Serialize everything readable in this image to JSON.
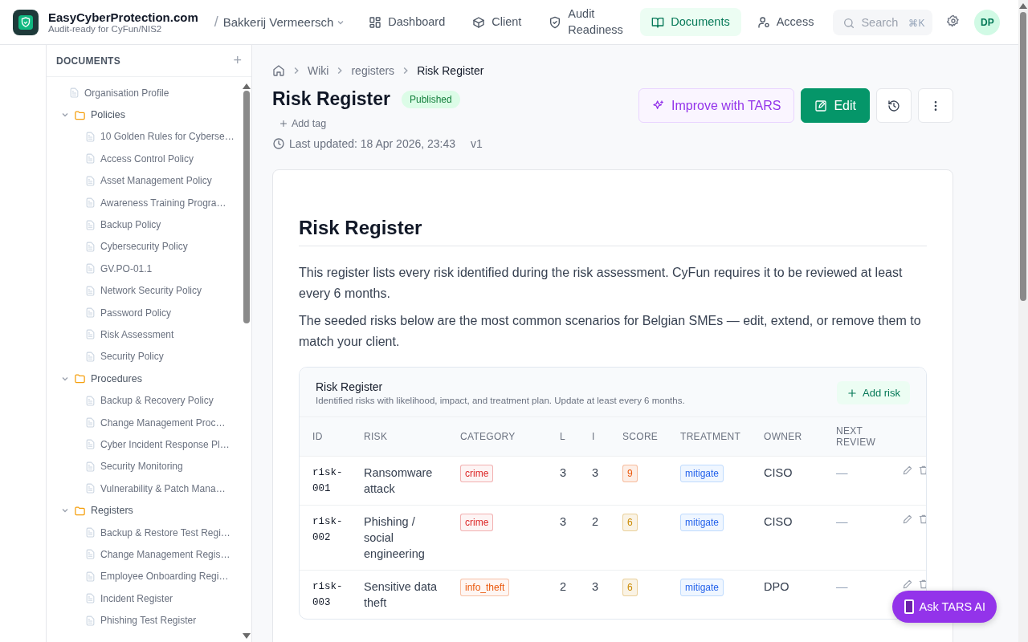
{
  "brand": {
    "name": "EasyCyberProtection.com",
    "tagline": "Audit-ready for CyFun/NIS2"
  },
  "workspace": {
    "separator": "/",
    "name": "Bakkerij Vermeersch"
  },
  "nav": [
    {
      "label": "Dashboard",
      "selected": false
    },
    {
      "label": "Client",
      "selected": false
    },
    {
      "label": "Audit Readiness",
      "selected": false
    },
    {
      "label": "Documents",
      "selected": true
    },
    {
      "label": "Access",
      "selected": false
    }
  ],
  "search": {
    "placeholder": "Search",
    "shortcut": "⌘K"
  },
  "avatar": "DP",
  "sidebar": {
    "title": "DOCUMENTS",
    "add": "+",
    "items": [
      {
        "kind": "file",
        "label": "Organisation Profile"
      },
      {
        "kind": "folder",
        "label": "Policies",
        "expanded": true,
        "children": [
          {
            "kind": "file",
            "label": "10 Golden Rules for Cyberse…"
          },
          {
            "kind": "file",
            "label": "Access Control Policy"
          },
          {
            "kind": "file",
            "label": "Asset Management Policy"
          },
          {
            "kind": "file",
            "label": "Awareness Training Progra…"
          },
          {
            "kind": "file",
            "label": "Backup Policy"
          },
          {
            "kind": "file",
            "label": "Cybersecurity Policy"
          },
          {
            "kind": "file",
            "label": "GV.PO-01.1"
          },
          {
            "kind": "file",
            "label": "Network Security Policy"
          },
          {
            "kind": "file",
            "label": "Password Policy"
          },
          {
            "kind": "file",
            "label": "Risk Assessment"
          },
          {
            "kind": "file",
            "label": "Security Policy"
          }
        ]
      },
      {
        "kind": "folder",
        "label": "Procedures",
        "expanded": true,
        "children": [
          {
            "kind": "file",
            "label": "Backup & Recovery Policy"
          },
          {
            "kind": "file",
            "label": "Change Management Proc…"
          },
          {
            "kind": "file",
            "label": "Cyber Incident Response Pl…"
          },
          {
            "kind": "file",
            "label": "Security Monitoring"
          },
          {
            "kind": "file",
            "label": "Vulnerability & Patch Mana…"
          }
        ]
      },
      {
        "kind": "folder",
        "label": "Registers",
        "expanded": true,
        "children": [
          {
            "kind": "file",
            "label": "Backup & Restore Test Regi…"
          },
          {
            "kind": "file",
            "label": "Change Management Regis…"
          },
          {
            "kind": "file",
            "label": "Employee Onboarding Regi…"
          },
          {
            "kind": "file",
            "label": "Incident Register"
          },
          {
            "kind": "file",
            "label": "Phishing Test Register"
          }
        ]
      }
    ]
  },
  "breadcrumb": [
    "Wiki",
    "registers",
    "Risk Register"
  ],
  "page": {
    "title": "Risk Register",
    "status": "Published",
    "add_tag": "Add tag",
    "updated": "Last updated: 18 Apr 2026, 23:43",
    "version": "v1"
  },
  "actions": {
    "improve": "Improve with TARS",
    "edit": "Edit"
  },
  "doc": {
    "heading": "Risk Register",
    "paragraphs": [
      "This register lists every risk identified during the risk assessment. CyFun requires it to be reviewed at least every 6 months.",
      "The seeded risks below are the most common scenarios for Belgian SMEs — edit, extend, or remove them to match your client."
    ]
  },
  "table": {
    "title": "Risk Register",
    "subtitle": "Identified risks with likelihood, impact, and treatment plan. Update at least every 6 months.",
    "add": "Add risk",
    "columns": [
      "ID",
      "RISK",
      "CATEGORY",
      "L",
      "I",
      "SCORE",
      "TREATMENT",
      "OWNER",
      "NEXT REVIEW"
    ],
    "rows": [
      {
        "id": "risk-001",
        "risk": "Ransomware attack",
        "category": {
          "label": "crime",
          "color": "#dc2626"
        },
        "l": "3",
        "i": "3",
        "score": {
          "value": "9",
          "color": "#ea580c"
        },
        "treatment": "mitigate",
        "owner": "CISO",
        "next_review": "—"
      },
      {
        "id": "risk-002",
        "risk": "Phishing / social engineering",
        "category": {
          "label": "crime",
          "color": "#dc2626"
        },
        "l": "3",
        "i": "2",
        "score": {
          "value": "6",
          "color": "#ca8a04"
        },
        "treatment": "mitigate",
        "owner": "CISO",
        "next_review": "—"
      },
      {
        "id": "risk-003",
        "risk": "Sensitive data theft",
        "category": {
          "label": "info_theft",
          "color": "#ea580c"
        },
        "l": "2",
        "i": "3",
        "score": {
          "value": "6",
          "color": "#ca8a04"
        },
        "treatment": "mitigate",
        "owner": "DPO",
        "next_review": "—"
      }
    ]
  },
  "assistant": {
    "label": "Ask TARS AI"
  }
}
